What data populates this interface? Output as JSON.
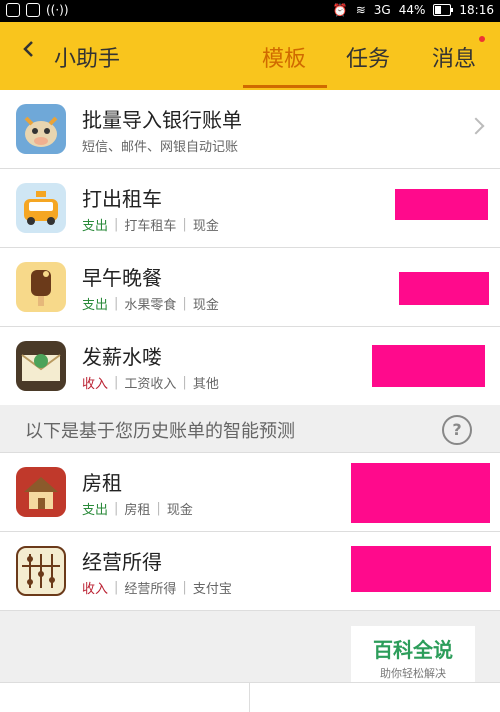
{
  "status_bar": {
    "network_label": "3G",
    "battery": "44%",
    "time": "18:16",
    "battery_level": 0.44
  },
  "header": {
    "title": "小助手",
    "tabs": [
      "模板",
      "任务",
      "消息"
    ],
    "active_tab": "模板"
  },
  "templates": [
    {
      "title": "批量导入银行账单",
      "subtitle": "短信、邮件、网银自动记账",
      "icon": "cow-bank-icon"
    },
    {
      "title": "打出租车",
      "type": "支出",
      "category": "打车租车",
      "account": "现金",
      "icon": "taxi-icon"
    },
    {
      "title": "早午晚餐",
      "type": "支出",
      "category": "水果零食",
      "account": "现金",
      "icon": "ice-cream-icon"
    },
    {
      "title": "发薪水喽",
      "type": "收入",
      "category": "工资收入",
      "account": "其他",
      "icon": "salary-envelope-icon"
    }
  ],
  "prediction_section": {
    "text": "以下是基于您历史账单的智能预测"
  },
  "predictions": [
    {
      "title": "房租",
      "type": "支出",
      "category": "房租",
      "account": "现金",
      "icon": "house-icon"
    },
    {
      "title": "经营所得",
      "type": "收入",
      "category": "经营所得",
      "account": "支付宝",
      "icon": "abacus-icon"
    }
  ],
  "watermark": {
    "title": "百科全说",
    "subtitle": "助你轻松解决"
  },
  "colors": {
    "header_bg": "#f9c51d",
    "accent": "#d06a00",
    "expense": "#2a8a3a",
    "income": "#b23333",
    "redaction": "#ff0a8c"
  }
}
